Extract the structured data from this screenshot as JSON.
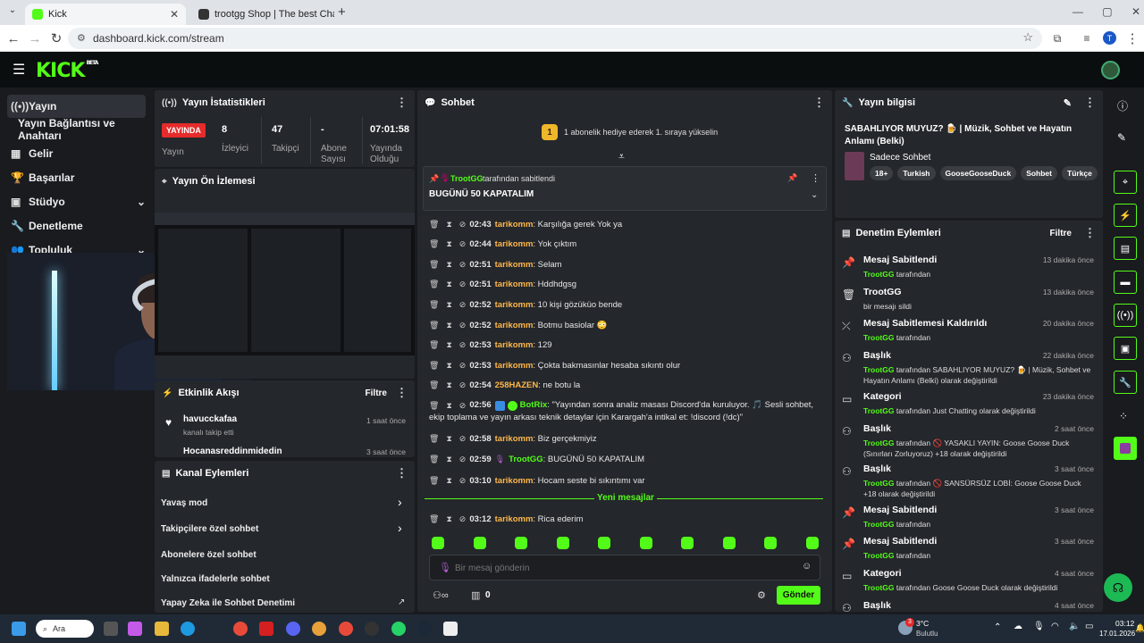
{
  "browser": {
    "tabs": [
      {
        "label": "Kick",
        "color": "#53fc18"
      },
      {
        "label": "trootgg Shop | The best ChatB",
        "color": "#333"
      }
    ],
    "url": "dashboard.kick.com/stream",
    "profile": "T"
  },
  "nav": {
    "items": [
      "Yayın",
      "Yayın Bağlantısı ve Anahtarı",
      "Gelir",
      "Başarılar",
      "Stüdyo",
      "Denetleme",
      "Topluluk"
    ]
  },
  "stats": {
    "title": "Yayın İstatistikleri",
    "live_badge": "YAYINDA",
    "live_label": "Yayın",
    "cells": [
      {
        "value": "8",
        "label": "İzleyici"
      },
      {
        "value": "47",
        "label": "Takipçi"
      },
      {
        "value": "-",
        "label": "Abone Sayısı"
      },
      {
        "value": "07:01:58",
        "label": "Yayında Olduğu"
      }
    ]
  },
  "preview": {
    "title": "Yayın Ön İzlemesi"
  },
  "activity": {
    "title": "Etkinlik Akışı",
    "filter": "Filtre",
    "items": [
      {
        "user": "havucckafaa",
        "desc": "kanalı takip etti",
        "time": "1 saat önce"
      },
      {
        "user": "Hocanasreddinmidedin",
        "time": "3 saat önce"
      }
    ]
  },
  "channel": {
    "title": "Kanal Eylemleri",
    "items": [
      "Yavaş mod",
      "Takipçilere özel sohbet",
      "Abonelere özel sohbet",
      "Yalnızca ifadelerle sohbet",
      "Yapay Zeka ile Sohbet Denetimi"
    ]
  },
  "chat": {
    "title": "Sohbet",
    "gift_num": "1",
    "gift_text": "1 abonelik hediye ederek 1. sıraya yükselin",
    "pinned_by": "TrootGG",
    "pinned_suffix": "tarafından sabitlendi",
    "pinned_text": "BUGÜNÜ 50 KAPATALIM",
    "messages": [
      {
        "time": "02:43",
        "user": "tarikomm",
        "text": "Karşılığa gerek Yok ya"
      },
      {
        "time": "02:44",
        "user": "tarikomm",
        "text": "Yok çıktım"
      },
      {
        "time": "02:51",
        "user": "tarikomm",
        "text": "Selam"
      },
      {
        "time": "02:51",
        "user": "tarikomm",
        "text": "Hddhdgsg"
      },
      {
        "time": "02:52",
        "user": "tarikomm",
        "text": "10 kişi gözüküo bende"
      },
      {
        "time": "02:52",
        "user": "tarikomm",
        "text": "Botmu basiolar 😳"
      },
      {
        "time": "02:53",
        "user": "tarikomm",
        "text": "129"
      },
      {
        "time": "02:53",
        "user": "tarikomm",
        "text": "Çokta bakmasınlar hesaba sıkıntı olur"
      },
      {
        "time": "02:54",
        "user": "258HAZEN",
        "text": "ne botu la"
      }
    ],
    "bot": {
      "time": "02:56",
      "user": "BotRix",
      "line1": "\"Yayından sonra analiz masası Discord'da kuruluyor. 🎵 Sesli sohbet,",
      "line2": "ekip toplama ve yayın arkası teknik detaylar için Karargah'a intikal et: !discord (!dc)\""
    },
    "messages2": [
      {
        "time": "02:58",
        "user": "tarikomm",
        "text": "Biz gerçekmiyiz"
      },
      {
        "time": "02:59",
        "user": "TrootGG",
        "text": "BUGÜNÜ 50 KAPATALIM"
      },
      {
        "time": "03:10",
        "user": "tarikomm",
        "text": "Hocam seste bi sıkıntımı var"
      }
    ],
    "new_label": "Yeni mesajlar",
    "last": {
      "time": "03:12",
      "user": "tarikomm",
      "text": "Rica ederim"
    },
    "placeholder": "Bir mesaj gönderin",
    "count": "0",
    "send": "Gönder"
  },
  "info": {
    "title": "Yayın bilgisi",
    "stream_title": "SABAHLIYOR MUYUZ? 🍺 | Müzik, Sohbet ve Hayatın Anlamı (Belki)",
    "category": "Sadece Sohbet",
    "tags": [
      "18+",
      "Turkish",
      "GooseGooseDuck",
      "Sohbet",
      "Türkçe"
    ]
  },
  "mod": {
    "title": "Denetim Eylemleri",
    "filter": "Filtre",
    "items": [
      {
        "icon": "pin-icon",
        "title": "Mesaj Sabitlendi",
        "desc": "TrootGG tarafından",
        "time": "13 dakika önce"
      },
      {
        "icon": "trash-icon",
        "title": "TrootGG",
        "desc": "bir mesajı sildi",
        "time": "13 dakika önce"
      },
      {
        "icon": "unpin-icon",
        "title": "Mesaj Sabitlemesi Kaldırıldı",
        "desc": "TrootGG tarafından",
        "time": "20 dakika önce"
      },
      {
        "icon": "title-icon",
        "title": "Başlık",
        "desc": "TrootGG tarafından SABAHLIYOR MUYUZ? 🍺 | Müzik, Sohbet ve Hayatın Anlamı (Belki) olarak değiştirildi",
        "time": "22 dakika önce"
      },
      {
        "icon": "category-icon",
        "title": "Kategori",
        "desc": "TrootGG tarafından Just Chatting olarak değiştirildi",
        "time": "23 dakika önce"
      },
      {
        "icon": "title-icon",
        "title": "Başlık",
        "desc": "TrootGG tarafından 🚫 YASAKLI YAYIN: Goose Goose Duck (Sınırları Zorluyoruz) +18 olarak değiştirildi",
        "time": "2 saat önce"
      },
      {
        "icon": "title-icon",
        "title": "Başlık",
        "desc": "TrootGG tarafından 🚫 SANSÜRSÜZ LOBİ: Goose Goose Duck +18 olarak değiştirildi",
        "time": "3 saat önce"
      },
      {
        "icon": "pin-icon",
        "title": "Mesaj Sabitlendi",
        "desc": "TrootGG tarafından",
        "time": "3 saat önce"
      },
      {
        "icon": "pin-icon",
        "title": "Mesaj Sabitlendi",
        "desc": "TrootGG tarafından",
        "time": "3 saat önce"
      },
      {
        "icon": "category-icon",
        "title": "Kategori",
        "desc": "TrootGG tarafından Goose Goose Duck olarak değiştirildi",
        "time": "4 saat önce"
      },
      {
        "icon": "title-icon",
        "title": "Başlık",
        "desc": "",
        "time": "4 saat önce"
      }
    ]
  },
  "taskbar": {
    "search": "Ara",
    "weather_temp": "3°C",
    "weather_desc": "Bulutlu",
    "weather_badge": "3",
    "time": "03:12",
    "date": "17.01.2026"
  }
}
